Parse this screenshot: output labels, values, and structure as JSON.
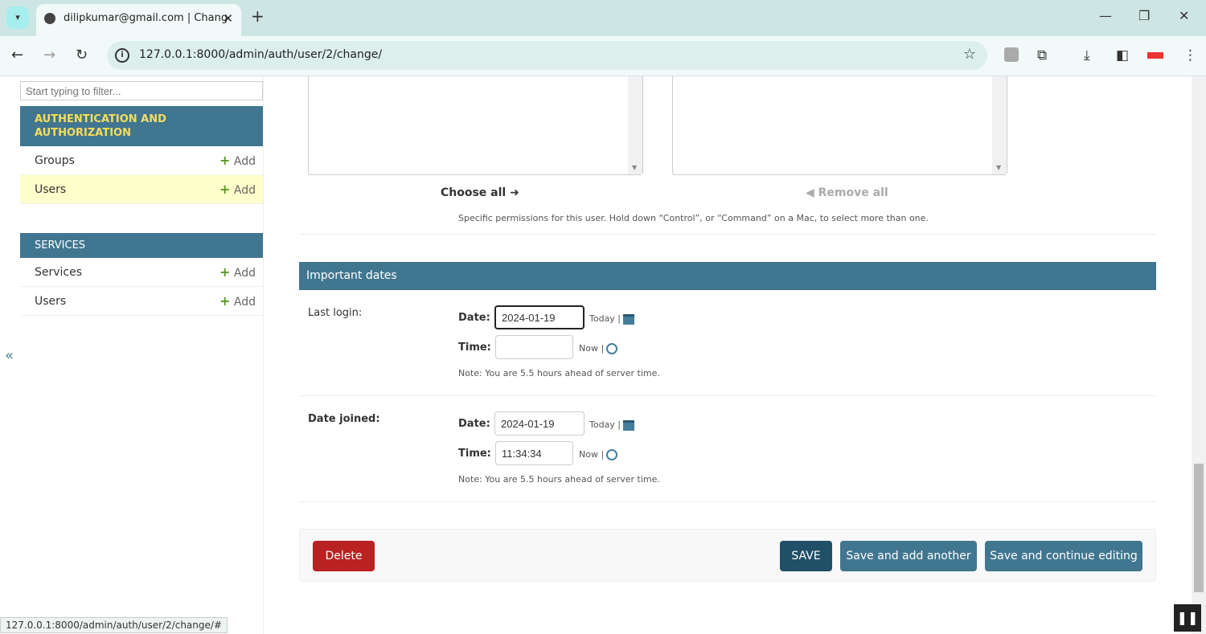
{
  "browser": {
    "tab_title": "dilipkumar@gmail.com | Chang",
    "url": "127.0.0.1:8000/admin/auth/user/2/change/",
    "status_url": "127.0.0.1:8000/admin/auth/user/2/change/#"
  },
  "sidebar": {
    "filter_placeholder": "Start typing to filter...",
    "collapse": "«",
    "modules": [
      {
        "caption": "AUTHENTICATION AND AUTHORIZATION",
        "items": [
          {
            "label": "Groups",
            "add": "Add"
          },
          {
            "label": "Users",
            "add": "Add",
            "selected": true
          }
        ]
      },
      {
        "caption": "SERVICES",
        "items": [
          {
            "label": "Services",
            "add": "Add"
          },
          {
            "label": "Users",
            "add": "Add"
          }
        ]
      }
    ]
  },
  "permissions": {
    "choose_all": "Choose all",
    "remove_all": "Remove all",
    "help": "Specific permissions for this user. Hold down “Control”, or “Command” on a Mac, to select more than one."
  },
  "important_dates": {
    "title": "Important dates",
    "last_login": {
      "label": "Last login:",
      "date_label": "Date:",
      "date_value": "2024-01-19",
      "today": "Today |",
      "time_label": "Time:",
      "time_value": "",
      "now": "Now |",
      "note": "Note: You are 5.5 hours ahead of server time."
    },
    "date_joined": {
      "label": "Date joined:",
      "date_label": "Date:",
      "date_value": "2024-01-19",
      "today": "Today |",
      "time_label": "Time:",
      "time_value": "11:34:34",
      "now": "Now |",
      "note": "Note: You are 5.5 hours ahead of server time."
    }
  },
  "actions": {
    "delete": "Delete",
    "save": "SAVE",
    "save_add": "Save and add another",
    "save_continue": "Save and continue editing"
  },
  "colors": {
    "header": "#417690",
    "delete": "#ba2121",
    "save": "#205067",
    "selected_row": "#ffffcc"
  }
}
